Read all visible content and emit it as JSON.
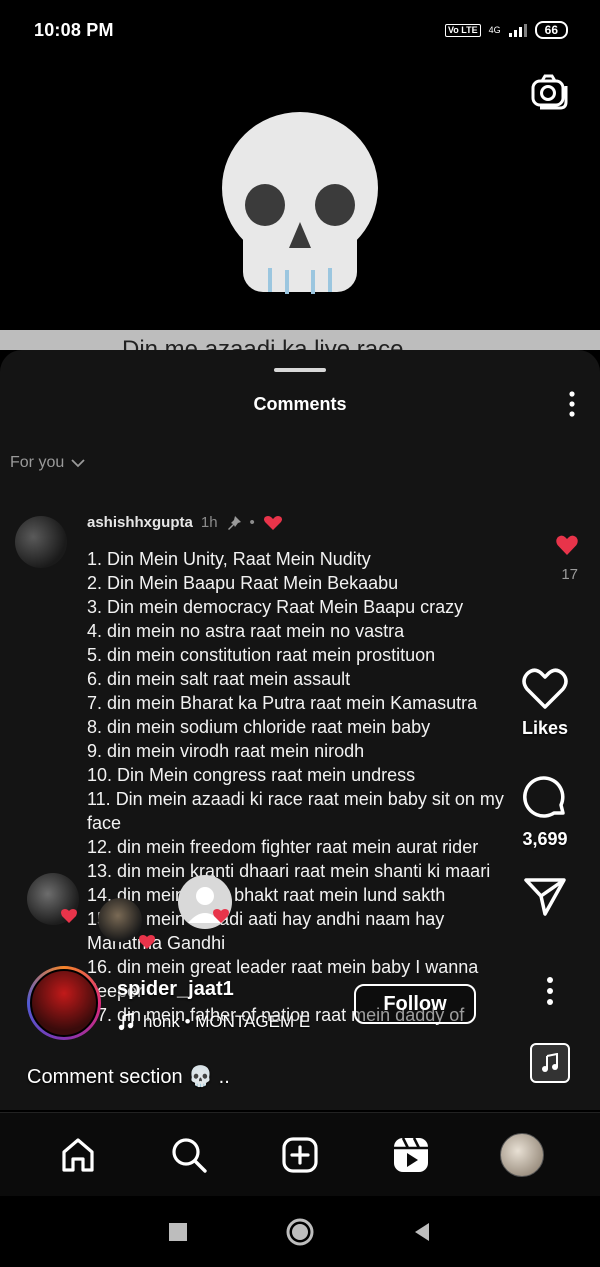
{
  "status_bar": {
    "time": "10:08 PM",
    "network": "4G",
    "volte": "Vo LTE",
    "battery": "66"
  },
  "video": {
    "emoji": "skull",
    "peek_text": "Din me azaadi ka liye race"
  },
  "sheet": {
    "title": "Comments",
    "filter_label": "For you"
  },
  "comment": {
    "username": "ashishhxgupta",
    "time": "1h",
    "like_count": "17",
    "lines": [
      "1. Din Mein Unity, Raat Mein Nudity",
      "2. Din Mein Baapu Raat Mein Bekaabu",
      "3. Din mein democracy Raat Mein Baapu crazy",
      "4. din mein no astra raat mein no vastra",
      "5. din mein constitution raat mein prostituon",
      "6. din mein salt raat mein assault",
      "7. din mein Bharat ka Putra raat mein Kamasutra",
      "8. din mein sodium chloride raat mein baby",
      "9. din mein virodh raat mein nirodh",
      "10. Din Mein congress raat mein undress",
      "11. Din mein azaadi ki race raat mein baby sit on my face",
      "12. din mein freedom fighter raat mein aurat rider",
      "13. din mein kranti dhaari raat mein shanti ki maari",
      "14. din mein desh bhakt raat mein lund sakth",
      "15. din mein azaadi aati hay andhi naam hay Mahatma Gandhi",
      "16. din mein great leader raat mein baby I wanna deeper",
      "17. din mein father of nation raat mein daddy of"
    ]
  },
  "reel": {
    "likes_label": "Likes",
    "comments_count": "3,699",
    "creator_name": "spider_jaat1",
    "audio": "honk • MONTAGEM E",
    "follow_label": "Follow",
    "caption": "Comment section"
  },
  "colors": {
    "heart": "#e8344a",
    "sheet_bg": "#141414",
    "muted_text": "#9a9a9a"
  },
  "nav": {
    "items": [
      "home-icon",
      "search-icon",
      "create-icon",
      "reels-icon",
      "profile-avatar"
    ]
  }
}
